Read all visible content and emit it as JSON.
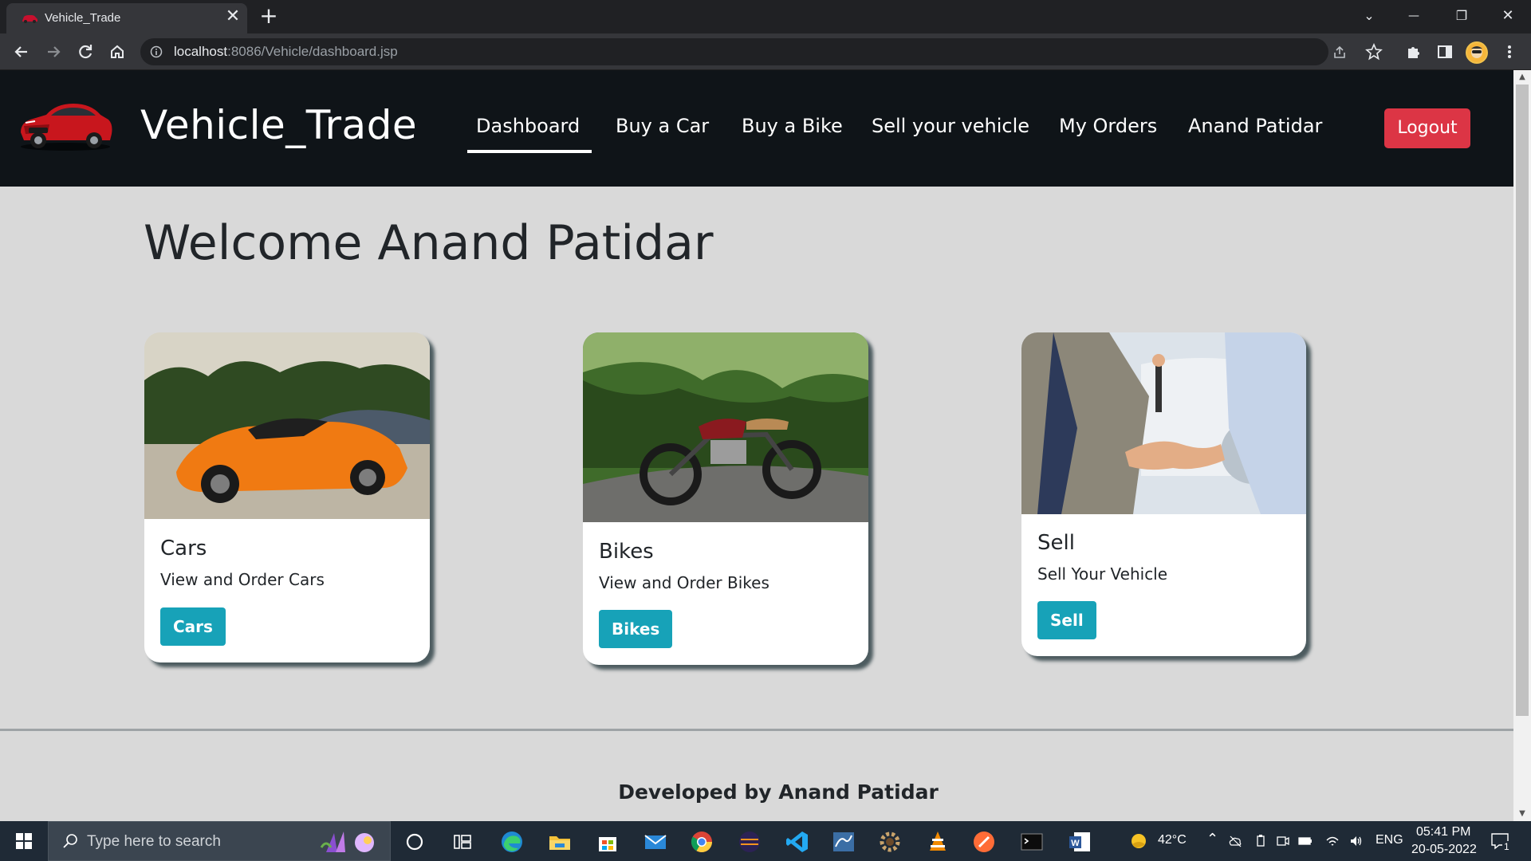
{
  "browser": {
    "tab_title": "Vehicle_Trade",
    "tab_close": "✕",
    "new_tab": "+",
    "url_host": "localhost",
    "url_rest": ":8086/Vehicle/dashboard.jsp",
    "window_controls": [
      "⌄",
      "—",
      "❐",
      "✕"
    ]
  },
  "site": {
    "brand": "Vehicle_Trade",
    "nav": [
      {
        "label": "Dashboard",
        "active": true
      },
      {
        "label": "Buy a Car"
      },
      {
        "label": "Buy a Bike"
      },
      {
        "label": "Sell your vehicle"
      },
      {
        "label": "My Orders"
      },
      {
        "label": "Anand Patidar"
      }
    ],
    "logout_label": "Logout",
    "welcome": "Welcome Anand Patidar",
    "cards": [
      {
        "title": "Cars",
        "text": "View and Order Cars",
        "button": "Cars",
        "image": "orange-sports-car"
      },
      {
        "title": "Bikes",
        "text": "View and Order Bikes",
        "button": "Bikes",
        "image": "motorcycle-on-road"
      },
      {
        "title": "Sell",
        "text": "Sell Your Vehicle",
        "button": "Sell",
        "image": "handshake-with-keys"
      }
    ],
    "footer": "Developed by Anand Patidar"
  },
  "taskbar": {
    "search_placeholder": "Type here to search",
    "weather": "42°C",
    "language": "ENG",
    "time": "05:41 PM",
    "date": "20-05-2022",
    "notifications": "1"
  },
  "colors": {
    "header_bg": "#0f1418",
    "page_bg": "#d9d9d9",
    "logout": "#dc3545",
    "card_button": "#17a2b8"
  }
}
